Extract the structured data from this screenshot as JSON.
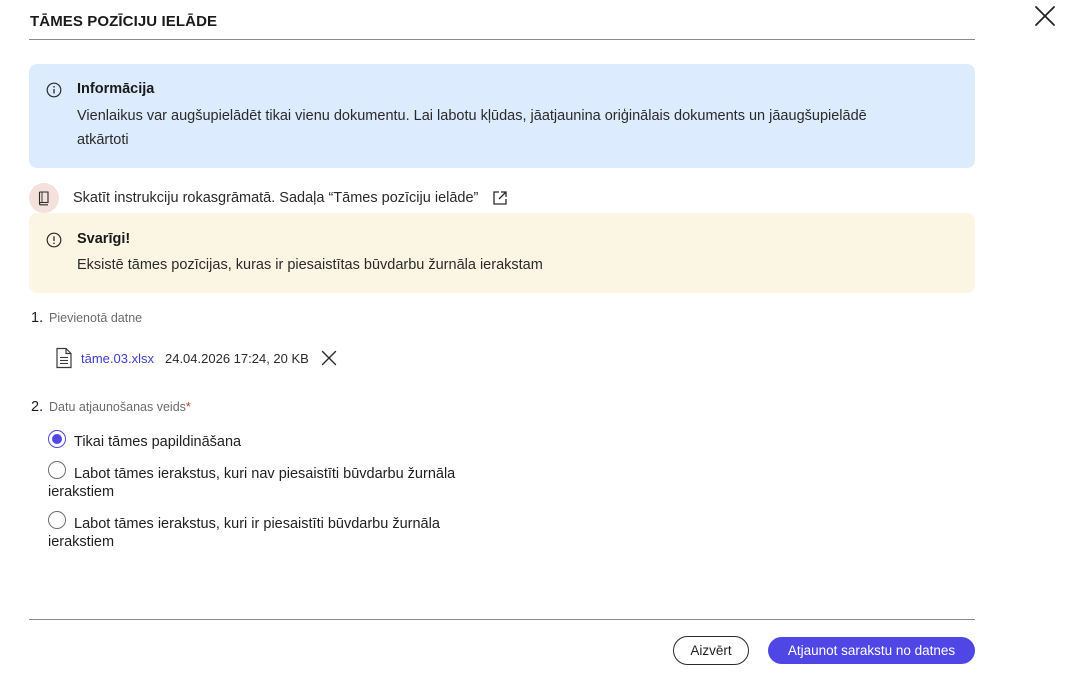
{
  "dialog": {
    "title": "TĀMES POZĪCIJU IELĀDE",
    "close_icon": "close-icon"
  },
  "info": {
    "icon": "info-icon",
    "title": "Informācija",
    "text_line1": "Vienlaikus var augšupielādēt tikai vienu dokumentu. Lai labotu kļūdas, jāatjaunina oriģinālais dokuments un jāaugšupielādē",
    "text_line2": "atkārtoti"
  },
  "manual": {
    "icon": "book-icon",
    "text": "Skatīt instrukciju rokasgrāmatā. Sadaļa “Tāmes pozīciju ielāde”",
    "link_icon": "external-link-icon"
  },
  "warning": {
    "icon": "exclamation-icon",
    "title": "Svarīgi!",
    "text": "Eksistē tāmes pozīcijas, kuras ir piesaistītas būvdarbu žurnāla ierakstam"
  },
  "step1": {
    "number": "1.",
    "label": "Pievienotā datne"
  },
  "file": {
    "icon": "document-icon",
    "name": "tāme.03.xlsx",
    "meta": "24.04.2026 17:24, 20 KB",
    "remove_icon": "close-icon"
  },
  "step2": {
    "number": "2.",
    "label": "Datu atjaunošanas veids",
    "required_mark": "*"
  },
  "options": [
    {
      "label": "Tikai tāmes papildināšana",
      "selected": true
    },
    {
      "label": "Labot tāmes ierakstus, kuri nav piesaistīti būvdarbu žurnāla ierakstiem",
      "selected": false
    },
    {
      "label": "Labot tāmes ierakstus, kuri ir piesaistīti būvdarbu žurnāla ierakstiem",
      "selected": false
    }
  ],
  "footer": {
    "close_label": "Aizvērt",
    "submit_label": "Atjaunot sarakstu no datnes"
  },
  "colors": {
    "accent": "#5046e5",
    "info_bg": "#dcebfd",
    "warning_bg": "#fbf5e3",
    "link": "#3c3fc8"
  }
}
